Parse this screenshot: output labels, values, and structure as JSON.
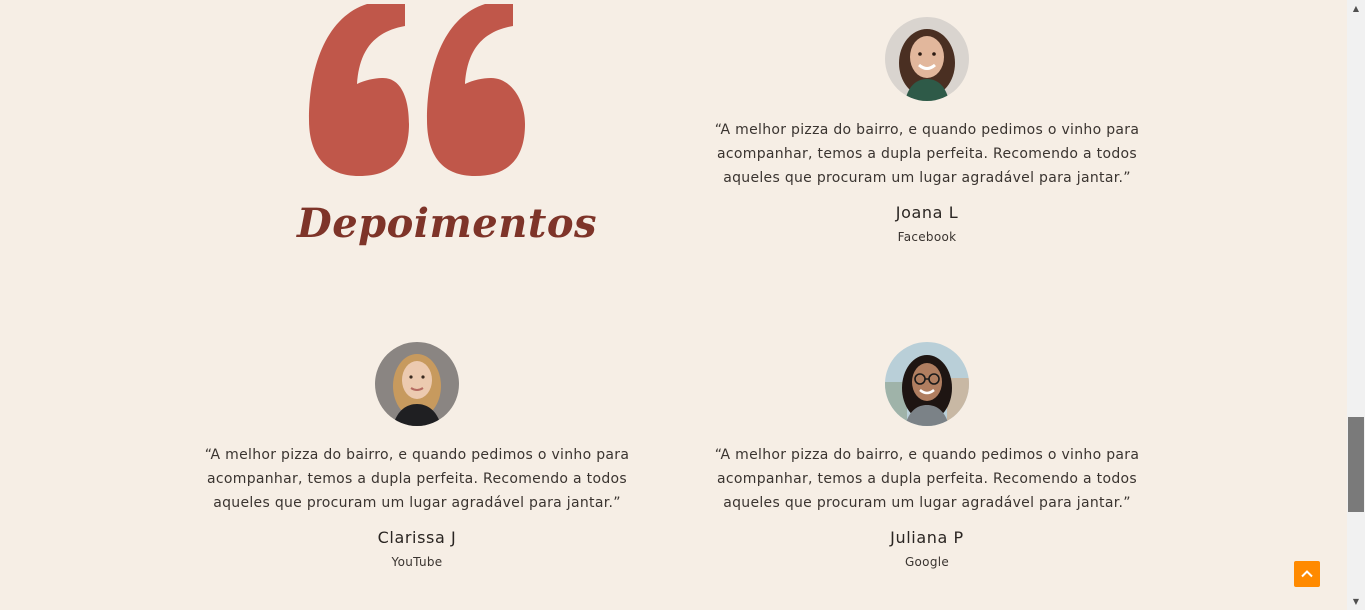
{
  "section": {
    "title": "Depoimentos",
    "quote_icon": "double-quote-icon",
    "accent_color": "#c0574a",
    "title_color": "#7e3429",
    "background": "#f6eee5"
  },
  "testimonials": [
    {
      "quote": "“A melhor pizza do bairro, e quando pedimos o vinho para acompanhar, temos a dupla perfeita. Recomendo a todos aqueles que procuram um lugar agradável para jantar.”",
      "name": "Joana L",
      "source": "Facebook"
    },
    {
      "quote": "“A melhor pizza do bairro, e quando pedimos o vinho para acompanhar, temos a dupla perfeita. Recomendo a todos aqueles que procuram um lugar agradável para jantar.”",
      "name": "Clarissa J",
      "source": "YouTube"
    },
    {
      "quote": "“A melhor pizza do bairro, e quando pedimos o vinho para acompanhar, temos a dupla perfeita. Recomendo a todos aqueles que procuram um lugar agradável para jantar.”",
      "name": "Juliana P",
      "source": "Google"
    }
  ],
  "back_to_top": {
    "icon": "chevron-up-icon",
    "color": "#ff8a00"
  }
}
